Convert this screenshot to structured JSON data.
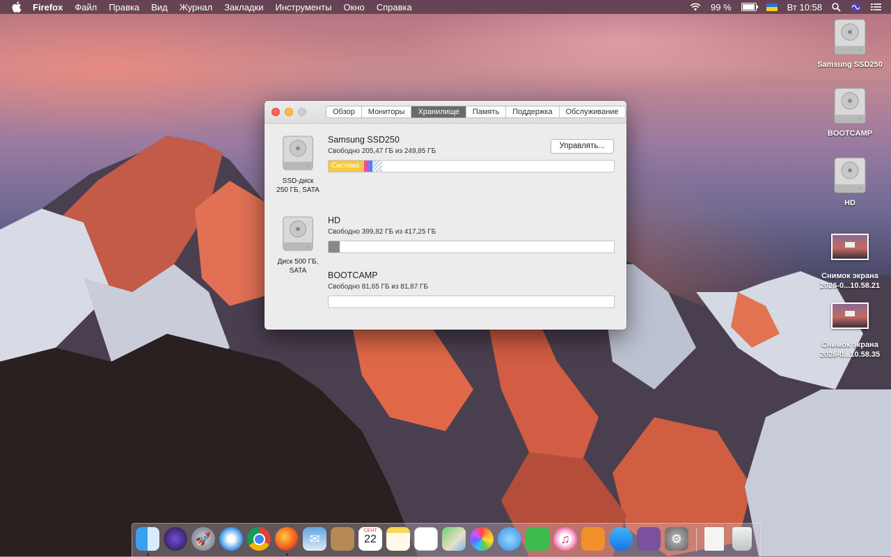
{
  "menubar": {
    "app": "Firefox",
    "items": [
      "Файл",
      "Правка",
      "Вид",
      "Журнал",
      "Закладки",
      "Инструменты",
      "Окно",
      "Справка"
    ],
    "battery": "99 %",
    "clock": "Вт 10:58"
  },
  "desktop": {
    "icons": [
      {
        "label": "Samsung SSD250"
      },
      {
        "label": "BOOTCAMP"
      },
      {
        "label": "HD"
      },
      {
        "label_line1": "Снимок экрана",
        "label_line2": "2026-0...10.58.21"
      },
      {
        "label_line1": "Снимок экрана",
        "label_line2": "2026-0...10.58.35"
      }
    ]
  },
  "window": {
    "tabs": [
      "Обзор",
      "Мониторы",
      "Хранилище",
      "Память",
      "Поддержка",
      "Обслуживание"
    ],
    "active_tab": "Хранилище",
    "drives": [
      {
        "caption_line1": "SSD-диск",
        "caption_line2": "250 ГБ, SATA"
      },
      {
        "caption_line1": "Диск 500 ГБ,",
        "caption_line2": "SATA"
      }
    ],
    "volumes": [
      {
        "name": "Samsung SSD250",
        "free": "Свободно 205,47 ГБ из 249,85 ГБ",
        "segment_label": "Система",
        "manage_button": "Управлять...",
        "used_fraction": 0.18
      },
      {
        "name": "HD",
        "free": "Свободно 399,82 ГБ из 417,25 ГБ",
        "used_fraction": 0.04
      },
      {
        "name": "BOOTCAMP",
        "free": "Свободно 81,65 ГБ из 81,87 ГБ",
        "used_fraction": 0.003
      }
    ]
  },
  "dock": {
    "apps": [
      {
        "icon": "finder-icon"
      },
      {
        "icon": "siri-icon"
      },
      {
        "icon": "launchpad-icon"
      },
      {
        "icon": "safari-icon"
      },
      {
        "icon": "chrome-icon"
      },
      {
        "icon": "firefox-icon"
      },
      {
        "icon": "mail-icon"
      },
      {
        "icon": "contacts-icon"
      },
      {
        "icon": "calendar-icon",
        "month": "СЕНТ",
        "day": "22"
      },
      {
        "icon": "notes-icon"
      },
      {
        "icon": "reminders-icon"
      },
      {
        "icon": "maps-icon"
      },
      {
        "icon": "photos-icon"
      },
      {
        "icon": "messages-icon"
      },
      {
        "icon": "facetime-icon"
      },
      {
        "icon": "itunes-icon"
      },
      {
        "icon": "books-icon"
      },
      {
        "icon": "appstore-icon"
      },
      {
        "icon": "viber-icon"
      },
      {
        "icon": "system-preferences-icon"
      },
      {
        "icon": "document-icon"
      },
      {
        "icon": "trash-icon"
      }
    ]
  }
}
